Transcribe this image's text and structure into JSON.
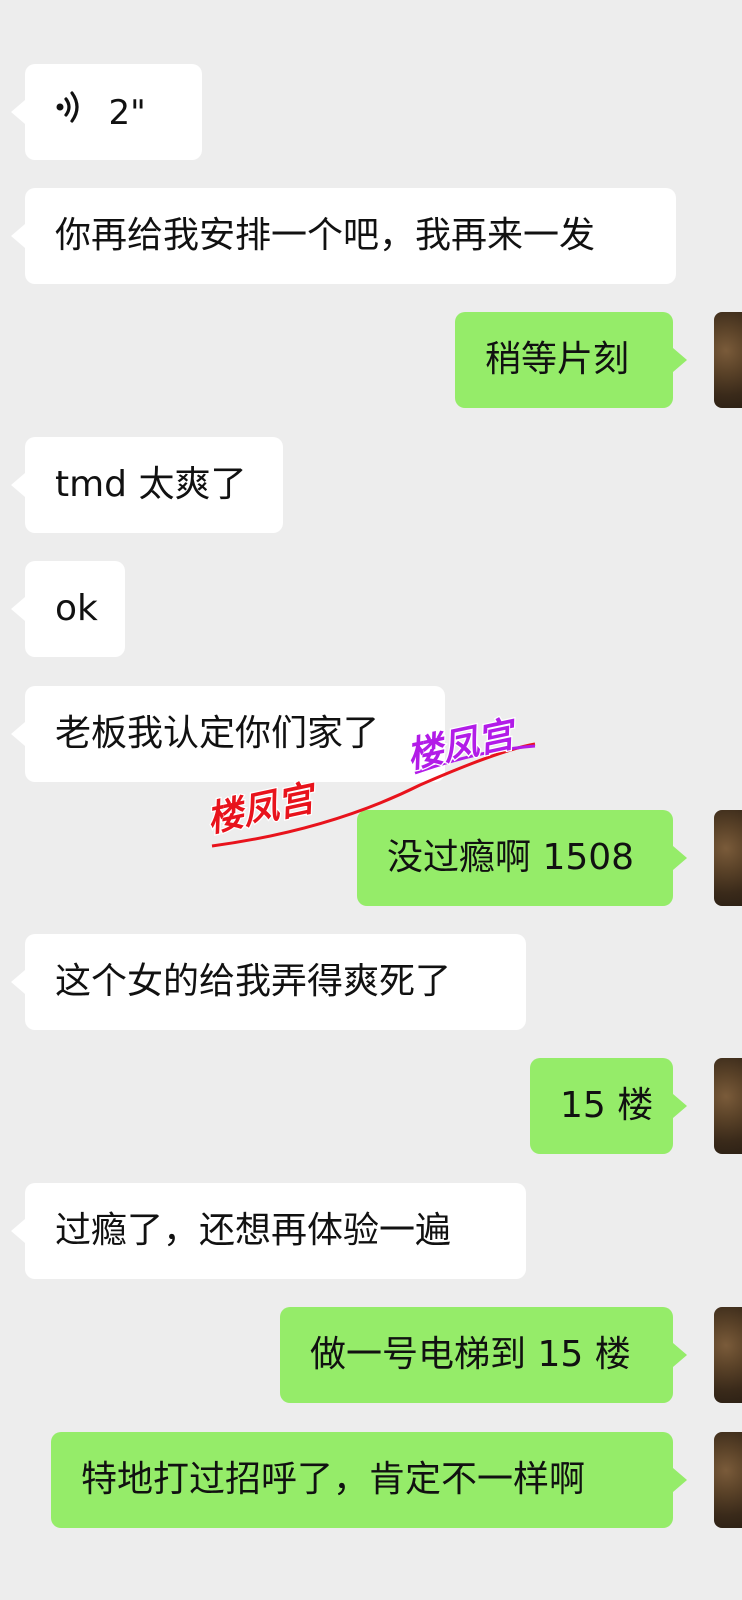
{
  "messages": [
    {
      "side": "in",
      "type": "voice",
      "duration": "2\""
    },
    {
      "side": "in",
      "text": "你再给我安排一个吧，我再来一发"
    },
    {
      "side": "out",
      "text": "稍等片刻"
    },
    {
      "side": "in",
      "text": "tmd 太爽了"
    },
    {
      "side": "in",
      "text": "ok"
    },
    {
      "side": "in",
      "text": "老板我认定你们家了"
    },
    {
      "side": "out",
      "text": "没过瘾啊 1508"
    },
    {
      "side": "in",
      "text": "这个女的给我弄得爽死了"
    },
    {
      "side": "out",
      "text": "15 楼"
    },
    {
      "side": "in",
      "text": "过瘾了，还想再体验一遍"
    },
    {
      "side": "out",
      "text": "做一号电梯到 15 楼"
    },
    {
      "side": "out",
      "text": "特地打过招呼了，肯定不一样啊"
    }
  ],
  "watermark": {
    "text_left": "楼凤宫",
    "text_right": "楼凤宫",
    "color_left": "#e8131c",
    "color_right": "#b21ce8"
  },
  "colors": {
    "background": "#ededed",
    "incoming_bubble": "#ffffff",
    "outgoing_bubble": "#95ec69"
  }
}
